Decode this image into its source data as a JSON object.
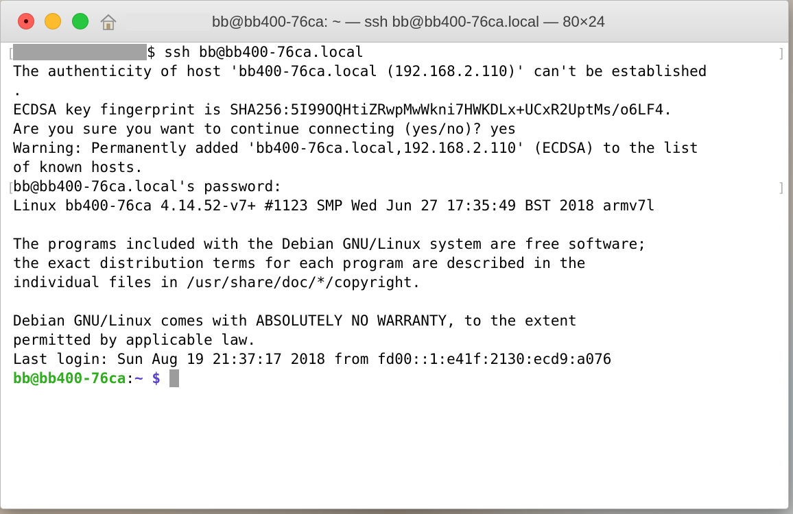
{
  "window": {
    "title": "bb@bb400-76ca: ~ — ssh bb@bb400-76ca.local — 80×24"
  },
  "icons": {
    "close": "close-button",
    "minimize": "minimize-button",
    "zoom": "zoom-button",
    "home": "home-folder-icon"
  },
  "terminal": {
    "command_prompt_suffix": "$ ssh bb@bb400-76ca.local",
    "lines": [
      "The authenticity of host 'bb400-76ca.local (192.168.2.110)' can't be established",
      ".",
      "ECDSA key fingerprint is SHA256:5I99OQHtiZRwpMwWkni7HWKDLx+UCxR2UptMs/o6LF4.",
      "Are you sure you want to continue connecting (yes/no)? yes",
      "Warning: Permanently added 'bb400-76ca.local,192.168.2.110' (ECDSA) to the list",
      "of known hosts.",
      "bb@bb400-76ca.local's password:",
      "Linux bb400-76ca 4.14.52-v7+ #1123 SMP Wed Jun 27 17:35:49 BST 2018 armv7l",
      "",
      "The programs included with the Debian GNU/Linux system are free software;",
      "the exact distribution terms for each program are described in the",
      "individual files in /usr/share/doc/*/copyright.",
      "",
      "Debian GNU/Linux comes with ABSOLUTELY NO WARRANTY, to the extent",
      "permitted by applicable law.",
      "Last login: Sun Aug 19 21:37:17 2018 from fd00::1:e41f:2130:ecd9:a076"
    ],
    "prompt": {
      "user_host": "bb@bb400-76ca",
      "colon": ":",
      "path": "~",
      "dollar": "$"
    }
  },
  "colors": {
    "prompt_user": "#2fad1f",
    "prompt_path": "#5a3fd6",
    "close": "#fc5f57",
    "minimize": "#fdbc2e",
    "zoom": "#27c840"
  }
}
